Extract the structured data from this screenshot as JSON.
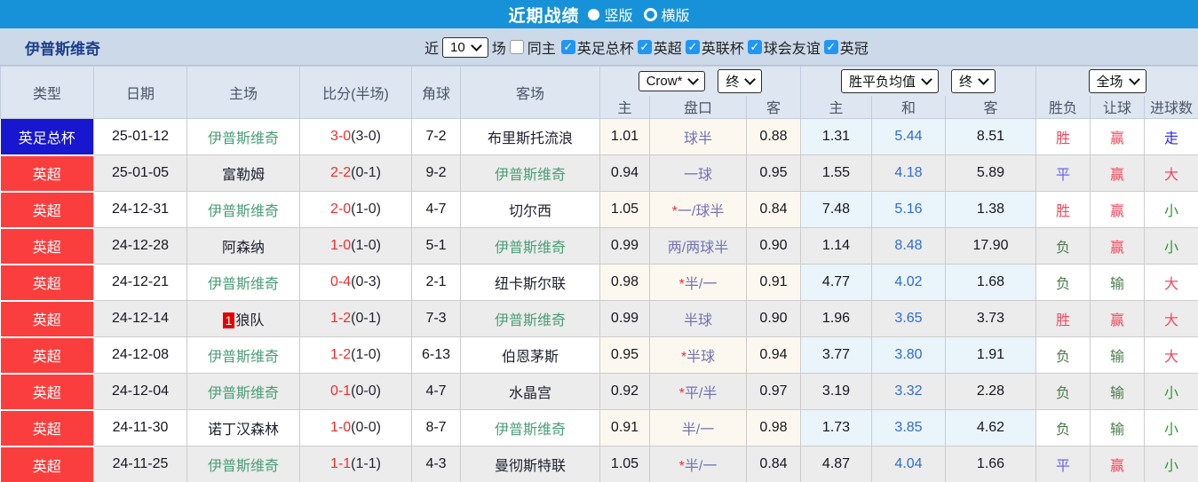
{
  "title_bar": {
    "title": "近期战绩",
    "options": [
      {
        "label": "竖版",
        "selected": true
      },
      {
        "label": "横版",
        "selected": false
      }
    ]
  },
  "filter_bar": {
    "team": "伊普斯维奇",
    "recent_label": "近",
    "match_count": "10",
    "games_label": "场",
    "same_home": {
      "label": "同主",
      "checked": false
    },
    "competitions": [
      {
        "label": "英足总杯",
        "checked": true
      },
      {
        "label": "英超",
        "checked": true
      },
      {
        "label": "英联杯",
        "checked": true
      },
      {
        "label": "球会友谊",
        "checked": true
      },
      {
        "label": "英冠",
        "checked": true
      }
    ]
  },
  "table": {
    "headers": {
      "type": "类型",
      "date": "日期",
      "home": "主场",
      "score": "比分(半场)",
      "corner": "角球",
      "away": "客场",
      "sub_odds": [
        "主",
        "盘口",
        "客"
      ],
      "sub_avg": [
        "主",
        "和",
        "客"
      ],
      "sub_result": [
        "胜负",
        "让球",
        "进球数"
      ]
    },
    "dropdowns": {
      "odds_source": "Crow*",
      "odds_time": "终",
      "avg_source": "胜平负均值",
      "avg_time": "终",
      "result_scope": "全场"
    },
    "colors": {
      "league_blue": "#1717cf",
      "league_red": "#fa3e3e",
      "win": "#f5485c",
      "draw": "#6666f0",
      "lose": "#4d7d4d",
      "cover": "#f5485c",
      "nocover": "#4d7d4d",
      "over": "#f5485c",
      "under": "#2f9a2f",
      "push": "#2a2af0"
    },
    "rows": [
      {
        "league": "英足总杯",
        "league_color": "blue",
        "date": "25-01-12",
        "home": "伊普斯维奇",
        "home_green": true,
        "home_badge": "",
        "score": "3-0",
        "half": "(3-0)",
        "corner": "7-2",
        "away": "布里斯托流浪",
        "away_green": false,
        "odds_home": "1.01",
        "star": false,
        "handicap": "球半",
        "odds_away": "0.88",
        "avg_home": "1.31",
        "avg_draw": "5.44",
        "avg_away": "8.51",
        "wl": "胜",
        "wl_c": "win",
        "hc": "赢",
        "hc_c": "cover",
        "goal": "走",
        "goal_c": "push"
      },
      {
        "league": "英超",
        "league_color": "red",
        "date": "25-01-05",
        "home": "富勒姆",
        "home_green": false,
        "home_badge": "",
        "score": "2-2",
        "half": "(0-1)",
        "corner": "9-2",
        "away": "伊普斯维奇",
        "away_green": true,
        "odds_home": "0.94",
        "star": false,
        "handicap": "一球",
        "odds_away": "0.95",
        "avg_home": "1.55",
        "avg_draw": "4.18",
        "avg_away": "5.89",
        "wl": "平",
        "wl_c": "draw",
        "hc": "赢",
        "hc_c": "cover",
        "goal": "大",
        "goal_c": "over"
      },
      {
        "league": "英超",
        "league_color": "red",
        "date": "24-12-31",
        "home": "伊普斯维奇",
        "home_green": true,
        "home_badge": "",
        "score": "2-0",
        "half": "(1-0)",
        "corner": "4-7",
        "away": "切尔西",
        "away_green": false,
        "odds_home": "1.05",
        "star": true,
        "handicap": "一/球半",
        "odds_away": "0.84",
        "avg_home": "7.48",
        "avg_draw": "5.16",
        "avg_away": "1.38",
        "wl": "胜",
        "wl_c": "win",
        "hc": "赢",
        "hc_c": "cover",
        "goal": "小",
        "goal_c": "under"
      },
      {
        "league": "英超",
        "league_color": "red",
        "date": "24-12-28",
        "home": "阿森纳",
        "home_green": false,
        "home_badge": "",
        "score": "1-0",
        "half": "(1-0)",
        "corner": "5-1",
        "away": "伊普斯维奇",
        "away_green": true,
        "odds_home": "0.99",
        "star": false,
        "handicap": "两/两球半",
        "odds_away": "0.90",
        "avg_home": "1.14",
        "avg_draw": "8.48",
        "avg_away": "17.90",
        "wl": "负",
        "wl_c": "lose",
        "hc": "赢",
        "hc_c": "cover",
        "goal": "小",
        "goal_c": "under"
      },
      {
        "league": "英超",
        "league_color": "red",
        "date": "24-12-21",
        "home": "伊普斯维奇",
        "home_green": true,
        "home_badge": "",
        "score": "0-4",
        "half": "(0-3)",
        "corner": "2-1",
        "away": "纽卡斯尔联",
        "away_green": false,
        "odds_home": "0.98",
        "star": true,
        "handicap": "半/一",
        "odds_away": "0.91",
        "avg_home": "4.77",
        "avg_draw": "4.02",
        "avg_away": "1.68",
        "wl": "负",
        "wl_c": "lose",
        "hc": "输",
        "hc_c": "nocover",
        "goal": "大",
        "goal_c": "over"
      },
      {
        "league": "英超",
        "league_color": "red",
        "date": "24-12-14",
        "home": "狼队",
        "home_green": false,
        "home_badge": "1",
        "score": "1-2",
        "half": "(0-1)",
        "corner": "7-3",
        "away": "伊普斯维奇",
        "away_green": true,
        "odds_home": "0.99",
        "star": false,
        "handicap": "半球",
        "odds_away": "0.90",
        "avg_home": "1.96",
        "avg_draw": "3.65",
        "avg_away": "3.73",
        "wl": "胜",
        "wl_c": "win",
        "hc": "赢",
        "hc_c": "cover",
        "goal": "大",
        "goal_c": "over"
      },
      {
        "league": "英超",
        "league_color": "red",
        "date": "24-12-08",
        "home": "伊普斯维奇",
        "home_green": true,
        "home_badge": "",
        "score": "1-2",
        "half": "(1-0)",
        "corner": "6-13",
        "away": "伯恩茅斯",
        "away_green": false,
        "odds_home": "0.95",
        "star": true,
        "handicap": "半球",
        "odds_away": "0.94",
        "avg_home": "3.77",
        "avg_draw": "3.80",
        "avg_away": "1.91",
        "wl": "负",
        "wl_c": "lose",
        "hc": "输",
        "hc_c": "nocover",
        "goal": "大",
        "goal_c": "over"
      },
      {
        "league": "英超",
        "league_color": "red",
        "date": "24-12-04",
        "home": "伊普斯维奇",
        "home_green": true,
        "home_badge": "",
        "score": "0-1",
        "half": "(0-0)",
        "corner": "4-7",
        "away": "水晶宫",
        "away_green": false,
        "odds_home": "0.92",
        "star": true,
        "handicap": "平/半",
        "odds_away": "0.97",
        "avg_home": "3.19",
        "avg_draw": "3.32",
        "avg_away": "2.28",
        "wl": "负",
        "wl_c": "lose",
        "hc": "输",
        "hc_c": "nocover",
        "goal": "小",
        "goal_c": "under"
      },
      {
        "league": "英超",
        "league_color": "red",
        "date": "24-11-30",
        "home": "诺丁汉森林",
        "home_green": false,
        "home_badge": "",
        "score": "1-0",
        "half": "(0-0)",
        "corner": "8-7",
        "away": "伊普斯维奇",
        "away_green": true,
        "odds_home": "0.91",
        "star": false,
        "handicap": "半/一",
        "odds_away": "0.98",
        "avg_home": "1.73",
        "avg_draw": "3.85",
        "avg_away": "4.62",
        "wl": "负",
        "wl_c": "lose",
        "hc": "输",
        "hc_c": "nocover",
        "goal": "小",
        "goal_c": "under"
      },
      {
        "league": "英超",
        "league_color": "red",
        "date": "24-11-25",
        "home": "伊普斯维奇",
        "home_green": true,
        "home_badge": "",
        "score": "1-1",
        "half": "(1-1)",
        "corner": "4-3",
        "away": "曼彻斯特联",
        "away_green": false,
        "odds_home": "1.05",
        "star": true,
        "handicap": "半/一",
        "odds_away": "0.84",
        "avg_home": "4.87",
        "avg_draw": "4.04",
        "avg_away": "1.66",
        "wl": "平",
        "wl_c": "draw",
        "hc": "赢",
        "hc_c": "cover",
        "goal": "小",
        "goal_c": "under"
      }
    ]
  }
}
